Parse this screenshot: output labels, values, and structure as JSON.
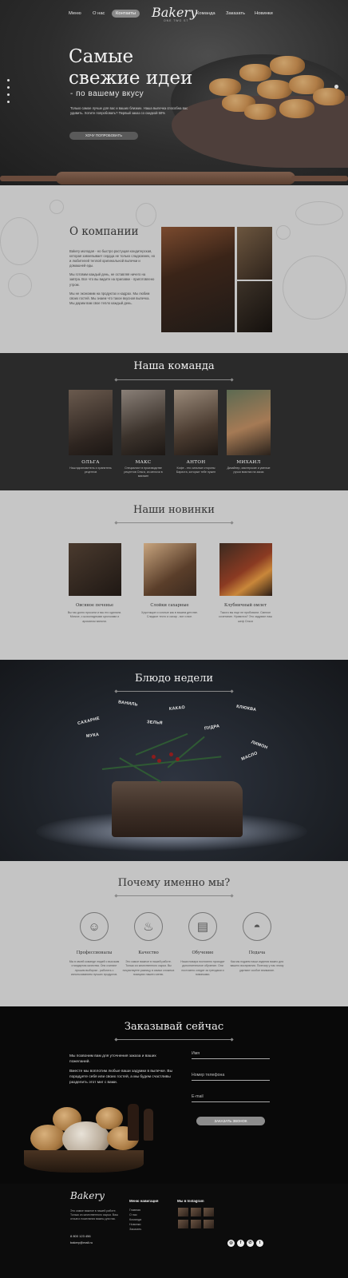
{
  "nav": {
    "left": [
      "Меню",
      "О нас",
      "Контакты"
    ],
    "right": [
      "Команда",
      "Заказать",
      "Новинки"
    ],
    "logo": "Bakery",
    "logo_sub": "ONE TWO ST"
  },
  "hero": {
    "title_line1": "Самые",
    "title_line2": "свежие идеи",
    "subtitle": "- по вашему вкусу",
    "text": "Только самое лучше для вас и ваших близких. Наша выпечка способна вас удивить. Хотите попробовать? Первый заказ со скидкой 50%",
    "button": "ХОЧУ ПОПРОБОВАТЬ"
  },
  "about": {
    "title": "О компании",
    "p1": "Bakery молодая - но быстро растущая кондитерская, которая завоевывает сердца не только сладкоежек, но и любителей теплой оригинальной выпечки и домашней еды.",
    "p2": "Мы готовим каждый день, не оставляя ничего на завтра. Все что вы видите на прилавке - приготовлено утром.",
    "p3": "Мы не экономим на продуктах и кадрах. Мы любим своих гостей. Мы знаем что такое вкусная выпечка. Мы дарим вам свое тепло каждый день."
  },
  "team": {
    "title": "Наша команда",
    "members": [
      {
        "name": "ОЛЬГА",
        "desc": "Наш вдохновитель и хранитель рецептов"
      },
      {
        "name": "МАКС",
        "desc": "Специалист в производстве рецептов Ольги, из мелочи в магазин"
      },
      {
        "name": "АНТОН",
        "desc": "Кофе - это сильные стороны Бариста, которые тебе нужен"
      },
      {
        "name": "МИХАИЛ",
        "desc": "Дизайнер, мастерские и умелые ручки визитки на заказ"
      }
    ]
  },
  "news": {
    "title": "Наши новинки",
    "items": [
      {
        "name": "Овсяное печенье",
        "desc": "Вы так долго просили и мы его сделали. Мягкое, с шоколадными кусочками и ароматом ванили."
      },
      {
        "name": "Слойки сахарные",
        "desc": "Хрустящие и сочные как в вашем детстве. Сладкое тесто и сахар - вот и все."
      },
      {
        "name": "Клубничный омлет",
        "desc": "Такого вы еще не пробовали. Смелое сочетание. Нравится? Это задумал наш шеф Ольги"
      }
    ]
  },
  "dish": {
    "title": "Блюдо недели",
    "words": [
      "ВАНИЛЬ",
      "КАКАО",
      "КЛЮКВА",
      "САХАРНЕ",
      "ЗЕЛЬЯ",
      "ПУДРА",
      "МУКА",
      "ЛИМОН",
      "МАСЛО"
    ]
  },
  "why": {
    "title": "Почему именно мы?",
    "features": [
      {
        "name": "Профессионалы",
        "desc": "Мы в своей команде людей с высоким стандартом качества. Они считают лучшим выбором - работать с использованием лучших продуктов."
      },
      {
        "name": "Качество",
        "desc": "Это самое важное в нашей работе. Только из качественного сырья. Вы почувствуете разницу в самых сложных позициях нашего меню."
      },
      {
        "name": "Обучение",
        "desc": "Наши повара постоянно проходят дополнительное обучение. Они постоянно следят за трендами и новинками."
      },
      {
        "name": "Подача",
        "desc": "Как мы подаем наши изделия важно для вашего восприятия. Поэтому у нас этому уделяют особое внимание."
      }
    ],
    "icons": [
      "chef-icon",
      "flour-bag-icon",
      "book-icon",
      "cloche-icon"
    ]
  },
  "order": {
    "title": "Заказывай сейчас",
    "p1": "Мы позвоним вам для уточнения заказа и ваших пожеланий.",
    "p2": "Вместе мы воплотим любые ваши задумки в выпечке. Вы порадуете себя или своих гостей, а мы будем счастливы разделить этот миг с вами.",
    "name_placeholder": "Имя",
    "phone_placeholder": "Номер телефона",
    "email_placeholder": "E-mail",
    "button": "ЗАКАЗАТЬ ЗВОНОК"
  },
  "footer": {
    "logo": "Bakery",
    "text": "Это самое важное в нашей работе. Только из качественного сырья. Ваш отзыв и пожелания важны для нас.",
    "phone": "8 800 123 456",
    "email": "bakery@mail.ru",
    "nav_title": "Меню навигация",
    "nav_items": [
      "Главная",
      "О нас",
      "Команда",
      "Новинки",
      "Заказать"
    ],
    "insta_title": "Мы в Instagram",
    "social": [
      "instagram-icon",
      "facebook-icon",
      "whatsapp-icon",
      "twitter-icon"
    ]
  }
}
